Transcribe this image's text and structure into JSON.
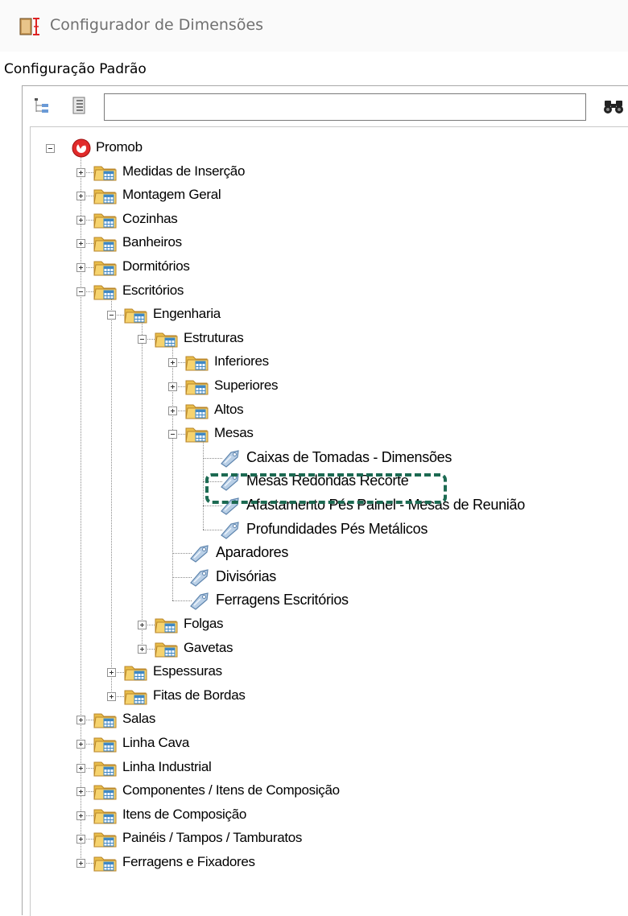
{
  "window": {
    "title": "Configurador de Dimensões",
    "icon": "ruler-book-icon"
  },
  "config_label": "Configuração Padrão",
  "toolbar": {
    "buttons": [
      {
        "name": "tree-collapse-icon"
      },
      {
        "name": "tree-expand-icon"
      }
    ],
    "search": {
      "value": "",
      "placeholder": ""
    },
    "find_icon": "binoculars-icon"
  },
  "highlight": {
    "color": "#1c6a52"
  },
  "tree": [
    {
      "label": "Promob",
      "level": 0,
      "type": "root",
      "expander": "minus"
    },
    {
      "label": "Medidas de Inserção",
      "level": 1,
      "type": "folder",
      "expander": "plus"
    },
    {
      "label": "Montagem Geral",
      "level": 1,
      "type": "folder",
      "expander": "plus"
    },
    {
      "label": "Cozinhas",
      "level": 1,
      "type": "folder",
      "expander": "plus"
    },
    {
      "label": "Banheiros",
      "level": 1,
      "type": "folder",
      "expander": "plus"
    },
    {
      "label": "Dormitórios",
      "level": 1,
      "type": "folder",
      "expander": "plus"
    },
    {
      "label": "Escritórios",
      "level": 1,
      "type": "folder",
      "expander": "minus"
    },
    {
      "label": "Engenharia",
      "level": 2,
      "type": "folder",
      "expander": "minus"
    },
    {
      "label": "Estruturas",
      "level": 3,
      "type": "folder",
      "expander": "minus"
    },
    {
      "label": "Inferiores",
      "level": 4,
      "type": "folder",
      "expander": "plus"
    },
    {
      "label": "Superiores",
      "level": 4,
      "type": "folder",
      "expander": "plus"
    },
    {
      "label": "Altos",
      "level": 4,
      "type": "folder",
      "expander": "plus"
    },
    {
      "label": "Mesas",
      "level": 4,
      "type": "folder",
      "expander": "minus"
    },
    {
      "label": "Caixas de Tomadas - Dimensões",
      "level": 5,
      "type": "leaf"
    },
    {
      "label": "Mesas Redondas Recorte",
      "level": 5,
      "type": "leaf",
      "highlighted": true
    },
    {
      "label": "Afastamento Pés Painel - Mesas de Reunião",
      "level": 5,
      "type": "leaf"
    },
    {
      "label": "Profundidades Pés Metálicos",
      "level": 5,
      "type": "leaf"
    },
    {
      "label": "Aparadores",
      "level": 4,
      "type": "leaf"
    },
    {
      "label": "Divisórias",
      "level": 4,
      "type": "leaf"
    },
    {
      "label": "Ferragens Escritórios",
      "level": 4,
      "type": "leaf"
    },
    {
      "label": "Folgas",
      "level": 3,
      "type": "folder",
      "expander": "plus"
    },
    {
      "label": "Gavetas",
      "level": 3,
      "type": "folder",
      "expander": "plus"
    },
    {
      "label": "Espessuras",
      "level": 2,
      "type": "folder",
      "expander": "plus"
    },
    {
      "label": "Fitas de Bordas",
      "level": 2,
      "type": "folder",
      "expander": "plus"
    },
    {
      "label": "Salas",
      "level": 1,
      "type": "folder",
      "expander": "plus"
    },
    {
      "label": "Linha Cava",
      "level": 1,
      "type": "folder",
      "expander": "plus"
    },
    {
      "label": "Linha Industrial",
      "level": 1,
      "type": "folder",
      "expander": "plus"
    },
    {
      "label": "Componentes / Itens de Composição",
      "level": 1,
      "type": "folder",
      "expander": "plus"
    },
    {
      "label": "Itens de Composição",
      "level": 1,
      "type": "folder",
      "expander": "plus"
    },
    {
      "label": "Painéis / Tampos / Tamburatos",
      "level": 1,
      "type": "folder",
      "expander": "plus"
    },
    {
      "label": "Ferragens e Fixadores",
      "level": 1,
      "type": "folder",
      "expander": "plus"
    }
  ]
}
